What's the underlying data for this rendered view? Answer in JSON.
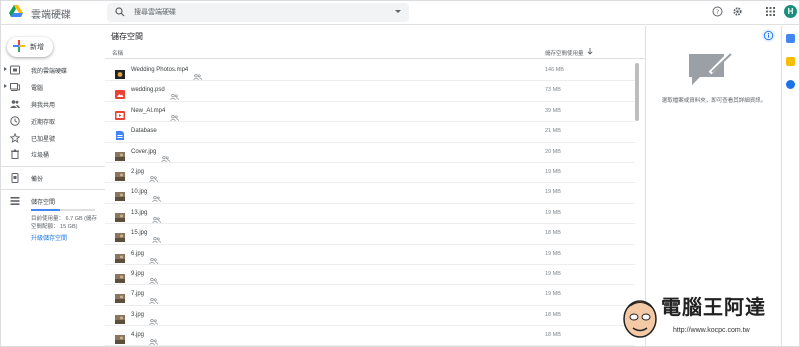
{
  "header": {
    "app_name": "雲端硬碟",
    "search_placeholder": "搜尋雲端硬碟",
    "avatar_letter": "H"
  },
  "sidebar": {
    "new_label": "新增",
    "items": [
      {
        "label": "我的雲端硬碟",
        "icon": "drive-icon",
        "expandable": true
      },
      {
        "label": "電腦",
        "icon": "computer-icon",
        "expandable": true
      },
      {
        "label": "與我共用",
        "icon": "shared-icon",
        "expandable": false
      },
      {
        "label": "近期存取",
        "icon": "clock-icon",
        "expandable": false
      },
      {
        "label": "已加星號",
        "icon": "star-icon",
        "expandable": false
      },
      {
        "label": "垃圾桶",
        "icon": "trash-icon",
        "expandable": false
      }
    ],
    "backup_label": "備份",
    "storage_label": "儲存空間",
    "storage_used_fraction": 0.45,
    "storage_text": "目前使用量： 6.7 GB (儲存空間配額： 15 GB)",
    "upgrade_label": "升級儲存空間"
  },
  "main": {
    "title": "儲存空間",
    "col_name": "名稱",
    "col_used": "儲存空間使用量",
    "files": [
      {
        "name": "Wedding Photos.mp4",
        "size": "146 MB",
        "type": "video-thumb",
        "shared": true
      },
      {
        "name": "wedding.psd",
        "size": "73 MB",
        "type": "image-red",
        "shared": true
      },
      {
        "name": "New_AI.mp4",
        "size": "39 MB",
        "type": "video-red",
        "shared": true
      },
      {
        "name": "Database",
        "size": "21 MB",
        "type": "doc-blue",
        "shared": false
      },
      {
        "name": "Cover.jpg",
        "size": "20 MB",
        "type": "photo",
        "shared": true
      },
      {
        "name": "2.jpg",
        "size": "19 MB",
        "type": "photo",
        "shared": true
      },
      {
        "name": "10.jpg",
        "size": "19 MB",
        "type": "photo",
        "shared": true
      },
      {
        "name": "13.jpg",
        "size": "19 MB",
        "type": "photo",
        "shared": true
      },
      {
        "name": "15.jpg",
        "size": "18 MB",
        "type": "photo",
        "shared": true
      },
      {
        "name": "6.jpg",
        "size": "19 MB",
        "type": "photo",
        "shared": true
      },
      {
        "name": "9.jpg",
        "size": "19 MB",
        "type": "photo",
        "shared": true
      },
      {
        "name": "7.jpg",
        "size": "19 MB",
        "type": "photo",
        "shared": true
      },
      {
        "name": "3.jpg",
        "size": "18 MB",
        "type": "photo",
        "shared": true
      },
      {
        "name": "4.jpg",
        "size": "18 MB",
        "type": "photo",
        "shared": true
      }
    ]
  },
  "details": {
    "hint": "選取檔案或資料夾，即可查看其詳細資訊。"
  },
  "watermark": {
    "title": "電腦王阿達",
    "url": "http://www.kocpc.com.tw"
  }
}
